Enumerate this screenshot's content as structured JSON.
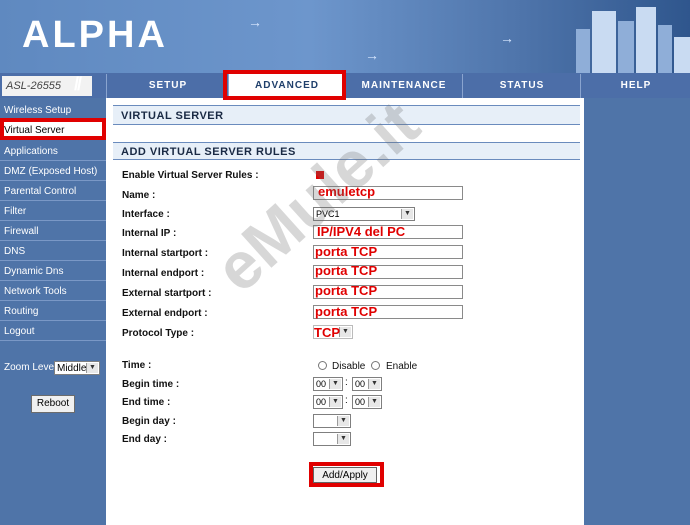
{
  "brand": {
    "logo": "ALPHA",
    "model": "ASL-26555"
  },
  "tabs": [
    {
      "label": "SETUP",
      "active": false
    },
    {
      "label": "ADVANCED",
      "active": true
    },
    {
      "label": "MAINTENANCE",
      "active": false
    },
    {
      "label": "STATUS",
      "active": false
    },
    {
      "label": "HELP",
      "active": false
    }
  ],
  "sidebar": {
    "items": [
      {
        "label": "Wireless Setup",
        "active": false
      },
      {
        "label": "Virtual Server",
        "active": true
      },
      {
        "label": "Applications",
        "active": false
      },
      {
        "label": "DMZ (Exposed Host)",
        "active": false
      },
      {
        "label": "Parental Control",
        "active": false
      },
      {
        "label": "Filter",
        "active": false
      },
      {
        "label": "Firewall",
        "active": false
      },
      {
        "label": "DNS",
        "active": false
      },
      {
        "label": "Dynamic Dns",
        "active": false
      },
      {
        "label": "Network Tools",
        "active": false
      },
      {
        "label": "Routing",
        "active": false
      },
      {
        "label": "Logout",
        "active": false
      }
    ],
    "zoom_label": "Zoom Level:",
    "zoom_value": "Middle",
    "reboot_label": "Reboot"
  },
  "main": {
    "section_title": "VIRTUAL SERVER",
    "rules_title": "ADD VIRTUAL SERVER RULES",
    "fields": {
      "enable_label": "Enable Virtual Server Rules :",
      "name_label": "Name :",
      "name_value": "emuletcp",
      "interface_label": "Interface :",
      "interface_value": "PVC1",
      "internal_ip_label": "Internal IP :",
      "internal_ip_value": "IP/IPV4 del PC",
      "internal_start_label": "Internal startport :",
      "internal_start_value": "porta TCP",
      "internal_end_label": "Internal endport :",
      "internal_end_value": "porta TCP",
      "external_start_label": "External startport :",
      "external_start_value": "porta TCP",
      "external_end_label": "External endport :",
      "external_end_value": "porta TCP",
      "protocol_label": "Protocol Type :",
      "protocol_value": "TCP"
    },
    "time": {
      "time_label": "Time :",
      "disable_label": "Disable",
      "enable_label": "Enable",
      "begin_time_label": "Begin time :",
      "end_time_label": "End time :",
      "begin_hour": "00",
      "begin_minute": "00",
      "end_hour": "00",
      "end_minute": "00",
      "colon": ":",
      "begin_day_label": "Begin day :",
      "end_day_label": "End day :"
    },
    "apply_label": "Add/Apply"
  },
  "watermark": "eMule.it",
  "colors": {
    "accent": "#e00000",
    "nav_blue": "#4c6ea8"
  }
}
